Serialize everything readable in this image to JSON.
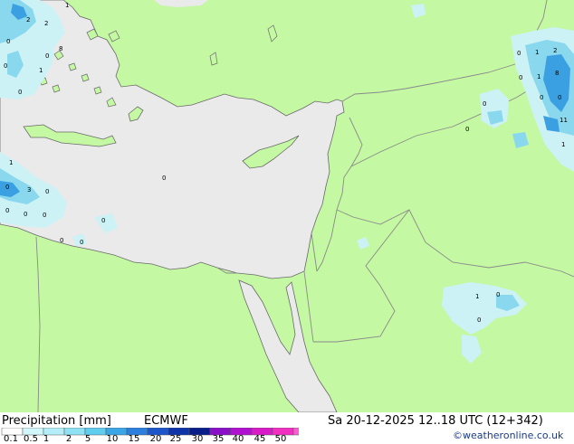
{
  "footer": {
    "title": "Precipitation [mm]",
    "model": "ECMWF",
    "datetime": "Sa 20-12-2025 12..18 UTC (12+342)",
    "copyright": "©weatheronline.co.uk"
  },
  "legend": {
    "ticks": [
      "0.1",
      "0.5",
      "1",
      "2",
      "5",
      "10",
      "15",
      "20",
      "25",
      "30",
      "35",
      "40",
      "45",
      "50"
    ],
    "colors": [
      "#ffffff",
      "#d2f7fb",
      "#b4eef8",
      "#8ee2f4",
      "#5fcdee",
      "#3aa6e6",
      "#2c7fdc",
      "#1c56c8",
      "#0f33a8",
      "#0a1e8a",
      "#8a10c8",
      "#b010d0",
      "#d81ac8",
      "#f030c0",
      "#ff5ad2"
    ]
  },
  "map": {
    "colors": {
      "land": "#c4f8a2",
      "sea": "#eaeaea",
      "border": "#8a8a8a",
      "coast": "#6a6a6a",
      "light_precip": "#cdf2f6",
      "mid_precip": "#8ad8ee",
      "heavy_precip": "#3aa0e2"
    },
    "values": [
      {
        "text": "2"
      },
      {
        "text": "2"
      },
      {
        "text": "8"
      },
      {
        "text": "1"
      },
      {
        "text": "0"
      },
      {
        "text": "0"
      },
      {
        "text": "0"
      },
      {
        "text": "1"
      },
      {
        "text": "0"
      },
      {
        "text": "3"
      },
      {
        "text": "0"
      },
      {
        "text": "0"
      },
      {
        "text": "0"
      },
      {
        "text": "0"
      },
      {
        "text": "0"
      },
      {
        "text": "0"
      },
      {
        "text": "0"
      },
      {
        "text": "0"
      },
      {
        "text": "0"
      },
      {
        "text": "1"
      },
      {
        "text": "2"
      },
      {
        "text": "0"
      },
      {
        "text": "1"
      },
      {
        "text": "8"
      },
      {
        "text": "0"
      },
      {
        "text": "0"
      },
      {
        "text": "11"
      },
      {
        "text": "1"
      },
      {
        "text": "0"
      },
      {
        "text": "0"
      },
      {
        "text": "1"
      },
      {
        "text": "0"
      },
      {
        "text": "0"
      },
      {
        "text": "1"
      },
      {
        "text": "0"
      }
    ]
  }
}
